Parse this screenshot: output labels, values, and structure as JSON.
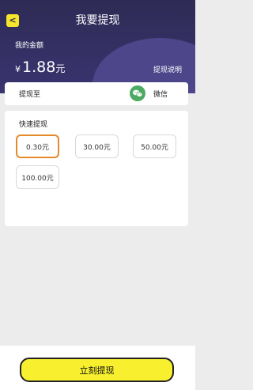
{
  "header": {
    "title": "我要提现",
    "back_icon": "chevron-left-icon",
    "balance_label": "我的金额",
    "currency_symbol": "¥",
    "balance_amount": "1.88",
    "balance_unit": "元",
    "explain_link": "提现说明"
  },
  "withdraw_to": {
    "label": "提现至",
    "method_icon": "wechat-icon",
    "method_label": "微信"
  },
  "quick": {
    "title": "快速提现",
    "options": [
      "0.30元",
      "30.00元",
      "50.00元",
      "100.00元"
    ],
    "selected_index": 0,
    "accent_color": "#e58a2c"
  },
  "submit": {
    "label": "立刻提现",
    "color": "#f8f02e"
  }
}
